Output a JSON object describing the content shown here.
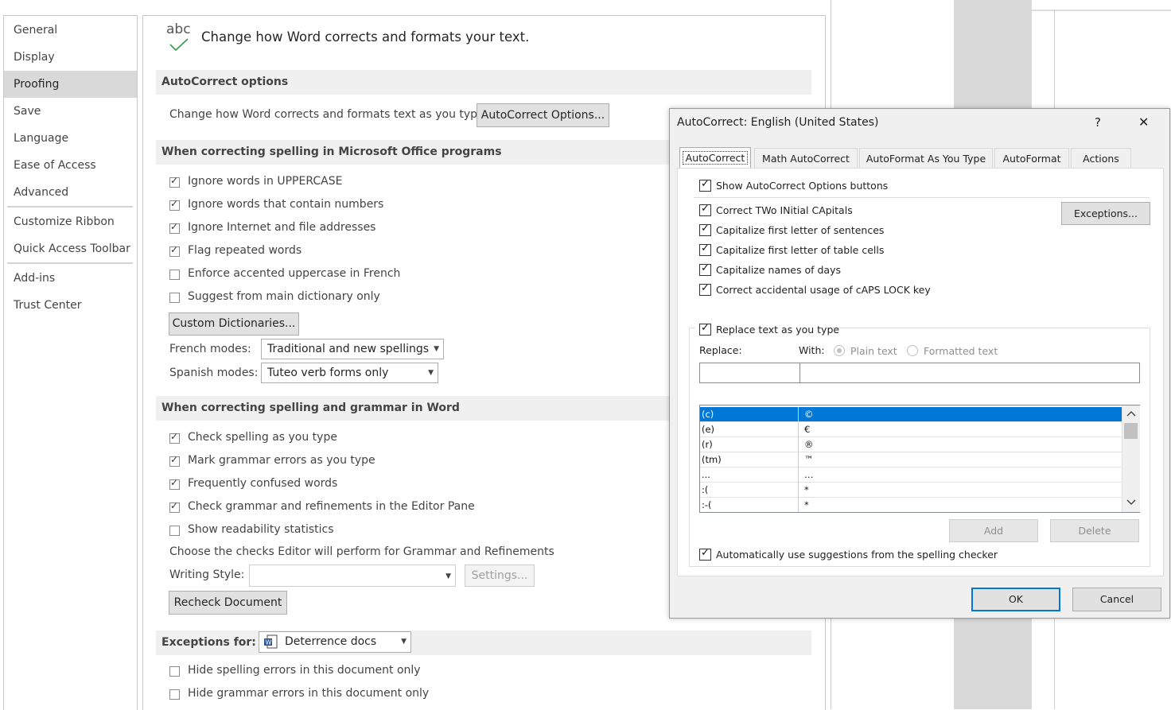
{
  "sidebar": {
    "items": [
      {
        "label": "General"
      },
      {
        "label": "Display"
      },
      {
        "label": "Proofing"
      },
      {
        "label": "Save"
      },
      {
        "label": "Language"
      },
      {
        "label": "Ease of Access"
      },
      {
        "label": "Advanced"
      },
      {
        "label": "Customize Ribbon"
      },
      {
        "label": "Quick Access Toolbar"
      },
      {
        "label": "Add-ins"
      },
      {
        "label": "Trust Center"
      }
    ],
    "selected": "Proofing"
  },
  "main": {
    "header_icon_text": "abc",
    "header_text": "Change how Word corrects and formats your text.",
    "autocorrect_section": {
      "title": "AutoCorrect options",
      "label": "Change how Word corrects and formats text as you type:",
      "button": "AutoCorrect Options..."
    },
    "office_section": {
      "title": "When correcting spelling in Microsoft Office programs",
      "options": [
        {
          "label": "Ignore words in UPPERCASE",
          "checked": true
        },
        {
          "label": "Ignore words that contain numbers",
          "checked": true
        },
        {
          "label": "Ignore Internet and file addresses",
          "checked": true
        },
        {
          "label": "Flag repeated words",
          "checked": true
        },
        {
          "label": "Enforce accented uppercase in French",
          "checked": false
        },
        {
          "label": "Suggest from main dictionary only",
          "checked": false
        }
      ],
      "custom_dict_button": "Custom Dictionaries...",
      "french_label": "French modes:",
      "french_value": "Traditional and new spellings",
      "spanish_label": "Spanish modes:",
      "spanish_value": "Tuteo verb forms only"
    },
    "word_section": {
      "title": "When correcting spelling and grammar in Word",
      "options": [
        {
          "label": "Check spelling as you type",
          "checked": true
        },
        {
          "label": "Mark grammar errors as you type",
          "checked": true
        },
        {
          "label": "Frequently confused words",
          "checked": true
        },
        {
          "label": "Check grammar and refinements in the Editor Pane",
          "checked": true
        },
        {
          "label": "Show readability statistics",
          "checked": false
        }
      ],
      "checks_text": "Choose the checks Editor will perform for Grammar and Refinements",
      "writing_style_label": "Writing Style:",
      "writing_style_value": "",
      "settings_button": "Settings...",
      "recheck_button": "Recheck Document"
    },
    "exceptions_section": {
      "title": "Exceptions for:",
      "document": "Deterrence docs",
      "options": [
        {
          "label": "Hide spelling errors in this document only",
          "checked": false
        },
        {
          "label": "Hide grammar errors in this document only",
          "checked": false
        }
      ]
    }
  },
  "dialog": {
    "title": "AutoCorrect: English (United States)",
    "help": "?",
    "close": "✕",
    "tabs": [
      {
        "label": "AutoCorrect",
        "active": true
      },
      {
        "label": "Math AutoCorrect",
        "active": false
      },
      {
        "label": "AutoFormat As You Type",
        "active": false
      },
      {
        "label": "AutoFormat",
        "active": false
      },
      {
        "label": "Actions",
        "active": false
      }
    ],
    "show_buttons": {
      "label": "Show AutoCorrect Options buttons",
      "checked": true
    },
    "options": [
      {
        "label": "Correct TWo INitial CApitals",
        "checked": true
      },
      {
        "label": "Capitalize first letter of sentences",
        "checked": true
      },
      {
        "label": "Capitalize first letter of table cells",
        "checked": true
      },
      {
        "label": "Capitalize names of days",
        "checked": true
      },
      {
        "label": "Correct accidental usage of cAPS LOCK key",
        "checked": true
      }
    ],
    "exceptions_button": "Exceptions...",
    "replace_as_you_type": {
      "label": "Replace text as you type",
      "checked": true
    },
    "replace_label": "Replace:",
    "with_label": "With:",
    "plain_text": "Plain text",
    "formatted_text": "Formatted text",
    "replace_value": "",
    "with_value": "",
    "entries": [
      {
        "from": "(c)",
        "to": "©"
      },
      {
        "from": "(e)",
        "to": "€"
      },
      {
        "from": "(r)",
        "to": "®"
      },
      {
        "from": "(tm)",
        "to": "™"
      },
      {
        "from": "...",
        "to": "…"
      },
      {
        "from": ":(",
        "to": "*"
      },
      {
        "from": ":-(",
        "to": "*"
      }
    ],
    "add_button": "Add",
    "delete_button": "Delete",
    "auto_suggest": {
      "label": "Automatically use suggestions from the spelling checker",
      "checked": true
    },
    "ok_button": "OK",
    "cancel_button": "Cancel"
  }
}
